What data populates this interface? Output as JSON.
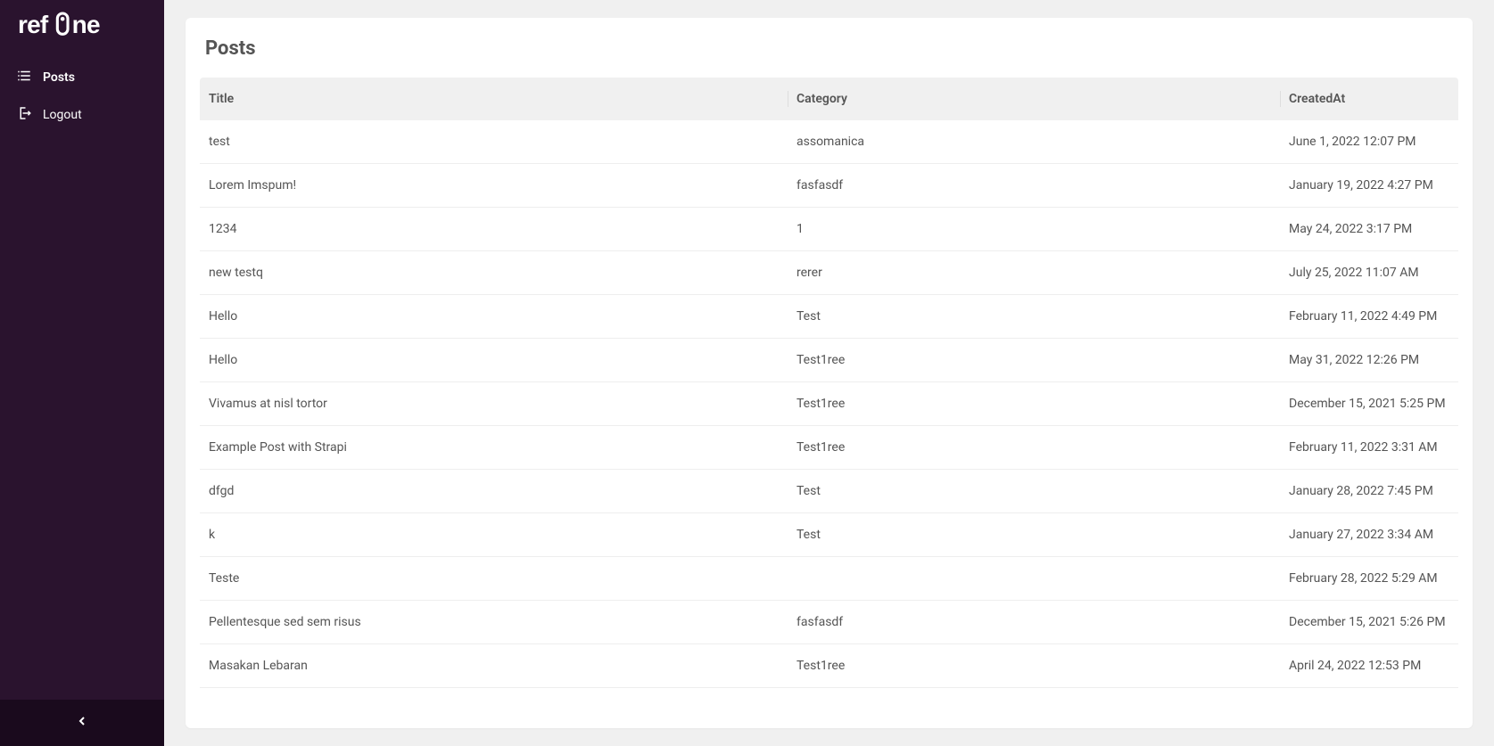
{
  "brand": "refine",
  "sidebar": {
    "items": [
      {
        "label": "Posts"
      },
      {
        "label": "Logout"
      }
    ]
  },
  "page": {
    "title": "Posts"
  },
  "table": {
    "columns": [
      "Title",
      "Category",
      "CreatedAt"
    ],
    "rows": [
      {
        "title": "test",
        "category": "assomanica",
        "created": "June 1, 2022 12:07 PM"
      },
      {
        "title": "Lorem Imspum!",
        "category": "fasfasdf",
        "created": "January 19, 2022 4:27 PM"
      },
      {
        "title": "1234",
        "category": "1",
        "created": "May 24, 2022 3:17 PM"
      },
      {
        "title": "new testq",
        "category": "rerer",
        "created": "July 25, 2022 11:07 AM"
      },
      {
        "title": "Hello",
        "category": "Test",
        "created": "February 11, 2022 4:49 PM"
      },
      {
        "title": "Hello",
        "category": "Test1ree",
        "created": "May 31, 2022 12:26 PM"
      },
      {
        "title": "Vivamus at nisl tortor",
        "category": "Test1ree",
        "created": "December 15, 2021 5:25 PM"
      },
      {
        "title": "Example Post with Strapi",
        "category": "Test1ree",
        "created": "February 11, 2022 3:31 AM"
      },
      {
        "title": "dfgd",
        "category": "Test",
        "created": "January 28, 2022 7:45 PM"
      },
      {
        "title": "k",
        "category": "Test",
        "created": "January 27, 2022 3:34 AM"
      },
      {
        "title": "Teste",
        "category": "",
        "created": "February 28, 2022 5:29 AM"
      },
      {
        "title": "Pellentesque sed sem risus",
        "category": "fasfasdf",
        "created": "December 15, 2021 5:26 PM"
      },
      {
        "title": "Masakan Lebaran",
        "category": "Test1ree",
        "created": "April 24, 2022 12:53 PM"
      }
    ]
  }
}
